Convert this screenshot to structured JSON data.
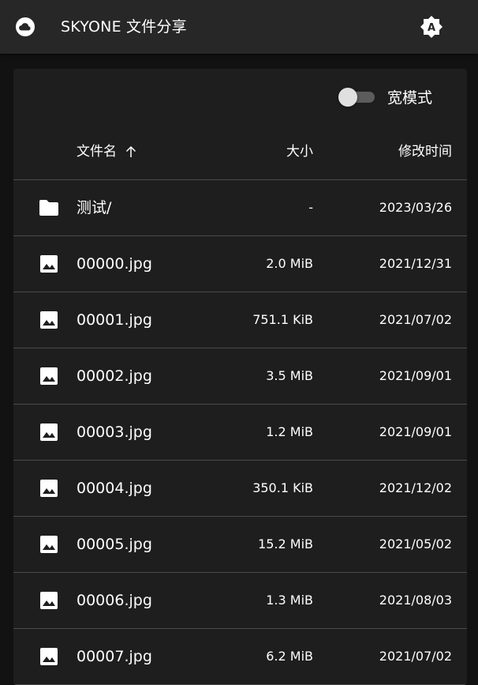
{
  "app": {
    "title": "SKYONE 文件分享",
    "logo_icon": "cloud-icon",
    "theme_icon": "brightness-auto-icon"
  },
  "toolbar": {
    "wide_mode_label": "宽模式",
    "wide_mode_on": false
  },
  "table": {
    "headers": {
      "name": "文件名",
      "size": "大小",
      "modified": "修改时间",
      "sort_icon": "arrow-up-icon"
    },
    "rows": [
      {
        "type": "folder",
        "icon": "folder-icon",
        "name": "测试/",
        "size": "-",
        "modified": "2023/03/26"
      },
      {
        "type": "image",
        "icon": "image-icon",
        "name": "00000.jpg",
        "size": "2.0 MiB",
        "modified": "2021/12/31"
      },
      {
        "type": "image",
        "icon": "image-icon",
        "name": "00001.jpg",
        "size": "751.1 KiB",
        "modified": "2021/07/02"
      },
      {
        "type": "image",
        "icon": "image-icon",
        "name": "00002.jpg",
        "size": "3.5 MiB",
        "modified": "2021/09/01"
      },
      {
        "type": "image",
        "icon": "image-icon",
        "name": "00003.jpg",
        "size": "1.2 MiB",
        "modified": "2021/09/01"
      },
      {
        "type": "image",
        "icon": "image-icon",
        "name": "00004.jpg",
        "size": "350.1 KiB",
        "modified": "2021/12/02"
      },
      {
        "type": "image",
        "icon": "image-icon",
        "name": "00005.jpg",
        "size": "15.2 MiB",
        "modified": "2021/05/02"
      },
      {
        "type": "image",
        "icon": "image-icon",
        "name": "00006.jpg",
        "size": "1.3 MiB",
        "modified": "2021/08/03"
      },
      {
        "type": "image",
        "icon": "image-icon",
        "name": "00007.jpg",
        "size": "6.2 MiB",
        "modified": "2021/07/02"
      }
    ]
  }
}
